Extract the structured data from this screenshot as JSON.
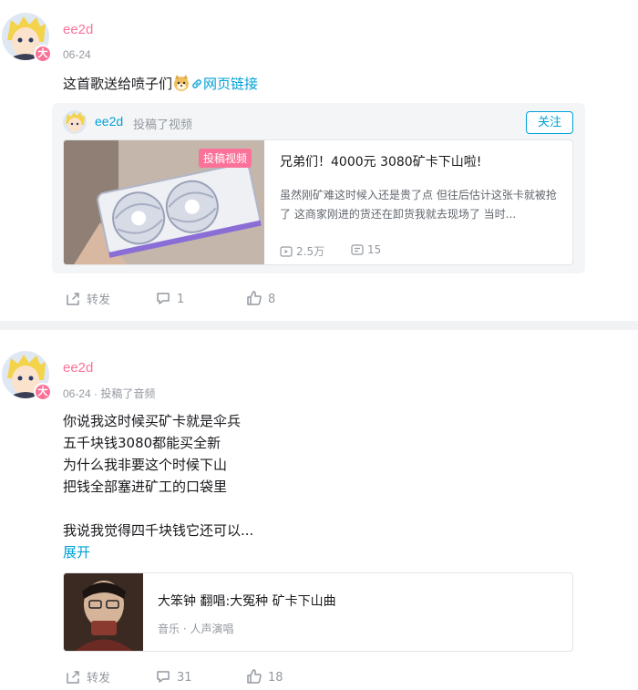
{
  "colors": {
    "accent_pink": "#fb7299",
    "link_blue": "#00a1d6",
    "muted": "#9499a0"
  },
  "post1": {
    "username": "ee2d",
    "badge": "大",
    "date": "06-24",
    "text_prefix": "这首歌送给喷子们",
    "link_text": "网页链接",
    "forward": {
      "username": "ee2d",
      "action": "投稿了视频",
      "follow_label": "关注",
      "video": {
        "cover_tag": "投稿视频",
        "title": "兄弟们！4000元 3080矿卡下山啦!",
        "desc": "虽然刚矿难这时候入还是贵了点 但往后估计这张卡就被抢了 这商家刚进的货还在卸货我就去现场了 当时...",
        "plays": "2.5万",
        "danmaku": "15"
      }
    },
    "actions": {
      "repost": "转发",
      "comments": "1",
      "likes": "8"
    }
  },
  "post2": {
    "username": "ee2d",
    "badge": "大",
    "meta": "06-24 · 投稿了音频",
    "lines": [
      "你说我这时候买矿卡就是伞兵",
      "五千块钱3080都能买全新",
      "为什么我非要这个时候下山",
      "把钱全部塞进矿工的口袋里",
      "",
      "我说我觉得四千块钱它还可以..."
    ],
    "expand": "展开",
    "audio": {
      "title": "大笨钟 翻唱:大冤种 矿卡下山曲",
      "sub": "音乐 · 人声演唱"
    },
    "actions": {
      "repost": "转发",
      "comments": "31",
      "likes": "18"
    }
  }
}
